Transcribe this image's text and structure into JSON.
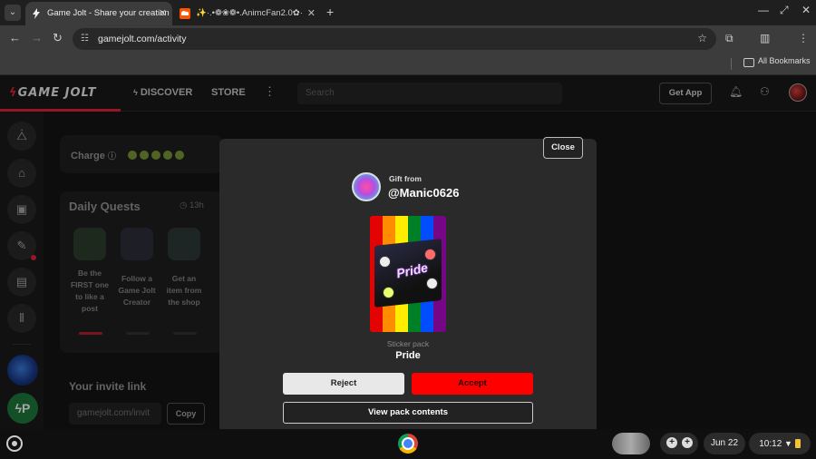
{
  "browser": {
    "tabs": [
      {
        "title": "Game Jolt - Share your creation",
        "active": true
      },
      {
        "title": "✨·.•❁❀❁•.AnimcFan2.0✿·",
        "active": false
      }
    ],
    "new_tab": "+",
    "url": "gamejolt.com/activity",
    "bookmarks_label": "All Bookmarks"
  },
  "site": {
    "logo": "GAME JOLT",
    "nav": {
      "discover": "DISCOVER",
      "store": "STORE"
    },
    "search_placeholder": "Search",
    "get_app": "Get App"
  },
  "sidebar": {
    "charge_label": "Charge",
    "daily_quests": {
      "title": "Daily Quests",
      "time": "13h",
      "quests": [
        {
          "text": "Be the FIRST one to like a post",
          "progress": 1
        },
        {
          "text": "Follow a Game Jolt Creator",
          "progress": 0
        },
        {
          "text": "Get an item from the shop",
          "progress": 0
        }
      ]
    },
    "invite": {
      "title": "Your invite link",
      "value": "gamejolt.com/invit",
      "copy_label": "Copy"
    }
  },
  "modal": {
    "close_label": "Close",
    "gift_from_label": "Gift from",
    "username": "@Manic0626",
    "pack_word": "Pride",
    "pack_type": "Sticker pack",
    "pack_name": "Pride",
    "reject_label": "Reject",
    "accept_label": "Accept",
    "view_label": "View pack contents"
  },
  "shelf": {
    "date": "Jun 22",
    "time": "10:12"
  },
  "colors": {
    "accent": "#ff0000",
    "brand_red": "#e8233a",
    "charge_green": "#7c9b3a"
  }
}
